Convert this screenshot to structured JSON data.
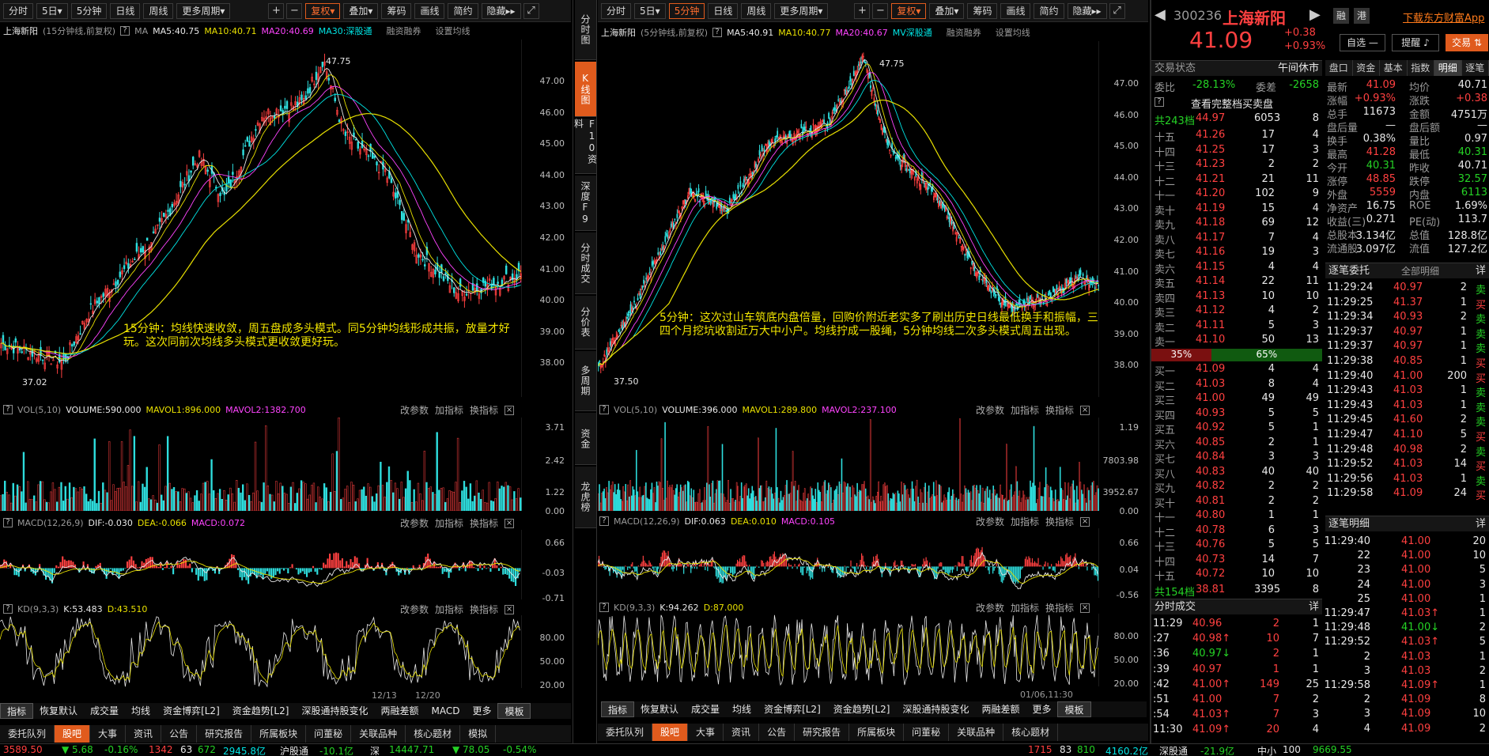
{
  "colors": {
    "accent": "#e05b1d",
    "up": "#ff4040",
    "down": "#25d225",
    "ma5": "#e8e8e8",
    "ma10": "#e8e000",
    "ma20": "#ff44ff",
    "ma30": "#00e5e5"
  },
  "toolbar_left": [
    "分时",
    "5日▾",
    "5分钟",
    "日线",
    "周线",
    "更多周期▾"
  ],
  "toolbar_left_b": [
    "复权▾",
    "叠加▾",
    "筹码",
    "画线",
    "简约",
    "隐藏▸▸"
  ],
  "toolbar_right": [
    "分时",
    "5日▾",
    "5分钟",
    "日线",
    "周线",
    "更多周期▾"
  ],
  "toolbar_right_b": [
    "复权▾",
    "叠加▾",
    "筹码",
    "画线",
    "简约",
    "隐藏▸▸"
  ],
  "left": {
    "name": "上海新阳",
    "period": "(15分钟线,前复权)",
    "ma_label": "MA",
    "ma5": "MA5:40.75",
    "ma10": "MA10:40.71",
    "ma20": "MA20:40.69",
    "ma30": "MA30:深股通",
    "rz": "融资融券",
    "set": "设置均线",
    "high_label": "47.75",
    "low_label": "37.02",
    "yticks": [
      "47.00",
      "46.00",
      "45.00",
      "44.00",
      "43.00",
      "42.00",
      "41.00",
      "40.00",
      "39.00",
      "38.00"
    ],
    "annotation": "15分钟：均线快速收敛，周五盘成多头模式。同5分钟均线形成共振，放量才好玩。这次同前次均线多头模式更收敛更好玩。",
    "vol": {
      "label": "VOL(5,10)",
      "v": "VOLUME:590.000",
      "m1": "MAVOL1:896.000",
      "m2": "MAVOL2:1382.700",
      "yt": [
        "3.71",
        "2.42",
        "1.22",
        "0.00"
      ]
    },
    "macd": {
      "label": "MACD(12,26,9)",
      "dif": "DIF:-0.030",
      "dea": "DEA:-0.066",
      "m": "MACD:0.072",
      "yt": [
        "0.66",
        "-0.03",
        "-0.71"
      ]
    },
    "kd": {
      "label": "KD(9,3,3)",
      "k": "K:53.483",
      "d": "D:43.510",
      "yt": [
        "80.00",
        "50.00",
        "20.00"
      ]
    },
    "btns": [
      "改参数",
      "加指标",
      "换指标"
    ],
    "dates": [
      "12/13",
      "12/20"
    ]
  },
  "right": {
    "name": "上海新阳",
    "period": "(5分钟线,前复权)",
    "ma5": "MA5:40.91",
    "ma10": "MA10:40.77",
    "ma20": "MA20:40.67",
    "ma30": "MV深股通",
    "rz": "融资融券",
    "set": "设置均线",
    "high_label": "47.75",
    "low_label": "37.50",
    "yticks": [
      "47.00",
      "46.00",
      "45.00",
      "44.00",
      "43.00",
      "42.00",
      "41.00",
      "40.00",
      "39.00",
      "38.00"
    ],
    "annotation": "5分钟：这次过山车筑底内盘倍量，回购价附近老实多了刷出历史日线最低换手和振幅，三四个月挖坑收割近万大中小户。均线拧成一股绳，5分钟均线二次多头模式周五出现。",
    "vol": {
      "label": "VOL(5,10)",
      "v": "VOLUME:396.000",
      "m1": "MAVOL1:289.800",
      "m2": "MAVOL2:237.100",
      "yt": [
        "1.19",
        "7803.98",
        "3952.67",
        "0.00"
      ]
    },
    "macd": {
      "label": "MACD(12,26,9)",
      "dif": "DIF:0.063",
      "dea": "DEA:0.010",
      "m": "MACD:0.105",
      "yt": [
        "0.66",
        "0.04",
        "-0.56"
      ]
    },
    "kd": {
      "label": "KD(9,3,3)",
      "k": "K:94.262",
      "d": "D:87.000",
      "yt": [
        "80.00",
        "50.00",
        "20.00"
      ]
    },
    "btns": [
      "改参数",
      "加指标",
      "换指标"
    ],
    "dates": [
      "01/06,11:30"
    ]
  },
  "vtabs": [
    "分时图",
    "K线图",
    "F10资料",
    "深度F9",
    "分时成交",
    "分价表",
    "多周期",
    "资金",
    "龙虎榜"
  ],
  "ind_tabs": [
    "指标",
    "恢复默认",
    "成交量",
    "均线",
    "资金博弈[L2]",
    "资金趋势[L2]",
    "深股通持股变化",
    "两融差额",
    "MACD",
    "更多",
    "模板"
  ],
  "ind_tabs_r": [
    "指标",
    "恢复默认",
    "成交量",
    "均线",
    "资金博弈[L2]",
    "资金趋势[L2]",
    "深股通持股变化",
    "两融差额",
    "更多",
    "模板"
  ],
  "bottom_tabs": [
    "委托队列",
    "股吧",
    "大事",
    "资讯",
    "公告",
    "研究报告",
    "所属板块",
    "问董秘",
    "关联品种",
    "核心题材",
    "模拟"
  ],
  "bottom_tabs_r": [
    "委托队列",
    "股吧",
    "大事",
    "资讯",
    "公告",
    "研究报告",
    "所属板块",
    "问董秘",
    "关联品种",
    "核心题材"
  ],
  "quote": {
    "code": "300236",
    "name": "上海新阳",
    "rong": "融",
    "gang": "港",
    "download": "下载东方财富App",
    "price": "41.09",
    "chg": "+0.38",
    "pct": "+0.93%",
    "zixuan": "自选 —",
    "tixing": "提醒 ♪",
    "jiaoyi": "交易 ⇅",
    "state_label": "交易状态",
    "state": "午间休市",
    "weibi_l": "委比",
    "weibi": "-28.13%",
    "weicha_l": "委差",
    "weicha": "-2658",
    "fulldepth": "查看完整档买卖盘",
    "ask_total": {
      "l": "共243档",
      "p": "44.97",
      "v": "6053",
      "n": "8"
    },
    "asks": [
      {
        "l": "十五",
        "p": "41.26",
        "v": "17",
        "n": "4"
      },
      {
        "l": "十四",
        "p": "41.25",
        "v": "17",
        "n": "3"
      },
      {
        "l": "十三",
        "p": "41.23",
        "v": "2",
        "n": "2"
      },
      {
        "l": "十二",
        "p": "41.21",
        "v": "21",
        "n": "11"
      },
      {
        "l": "十一",
        "p": "41.20",
        "v": "102",
        "n": "9"
      },
      {
        "l": "卖十",
        "p": "41.19",
        "v": "15",
        "n": "4"
      },
      {
        "l": "卖九",
        "p": "41.18",
        "v": "69",
        "n": "12"
      },
      {
        "l": "卖八",
        "p": "41.17",
        "v": "7",
        "n": "4"
      },
      {
        "l": "卖七",
        "p": "41.16",
        "v": "19",
        "n": "3"
      },
      {
        "l": "卖六",
        "p": "41.15",
        "v": "4",
        "n": "4"
      },
      {
        "l": "卖五",
        "p": "41.14",
        "v": "22",
        "n": "11"
      },
      {
        "l": "卖四",
        "p": "41.13",
        "v": "10",
        "n": "10"
      },
      {
        "l": "卖三",
        "p": "41.12",
        "v": "4",
        "n": "2"
      },
      {
        "l": "卖二",
        "p": "41.11",
        "v": "5",
        "n": "3"
      },
      {
        "l": "卖一",
        "p": "41.10",
        "v": "50",
        "n": "13"
      }
    ],
    "ratio_l": "35%",
    "ratio_r": "65%",
    "bids": [
      {
        "l": "买一",
        "p": "41.09",
        "v": "4",
        "n": "4"
      },
      {
        "l": "买二",
        "p": "41.03",
        "v": "8",
        "n": "4"
      },
      {
        "l": "买三",
        "p": "41.00",
        "v": "49",
        "n": "49"
      },
      {
        "l": "买四",
        "p": "40.93",
        "v": "5",
        "n": "5"
      },
      {
        "l": "买五",
        "p": "40.92",
        "v": "5",
        "n": "1"
      },
      {
        "l": "买六",
        "p": "40.85",
        "v": "2",
        "n": "1"
      },
      {
        "l": "买七",
        "p": "40.84",
        "v": "3",
        "n": "3"
      },
      {
        "l": "买八",
        "p": "40.83",
        "v": "40",
        "n": "40"
      },
      {
        "l": "买九",
        "p": "40.82",
        "v": "2",
        "n": "2"
      },
      {
        "l": "买十",
        "p": "40.81",
        "v": "2",
        "n": "2"
      },
      {
        "l": "十一",
        "p": "40.80",
        "v": "1",
        "n": "1"
      },
      {
        "l": "十二",
        "p": "40.78",
        "v": "6",
        "n": "3"
      },
      {
        "l": "十三",
        "p": "40.76",
        "v": "5",
        "n": "5"
      },
      {
        "l": "十四",
        "p": "40.73",
        "v": "14",
        "n": "7"
      },
      {
        "l": "十五",
        "p": "40.72",
        "v": "10",
        "n": "10"
      }
    ],
    "bid_total": {
      "l": "共154档",
      "p": "38.81",
      "v": "3395",
      "n": "8"
    },
    "side_tabs": [
      "盘口",
      "资金",
      "基本",
      "指数",
      "明细",
      "逐笔"
    ],
    "stats": [
      [
        "最新",
        "41.09",
        "均价",
        "40.71"
      ],
      [
        "涨幅",
        "+0.93%",
        "涨跌",
        "+0.38"
      ],
      [
        "总手",
        "11673",
        "金额",
        "4751万"
      ],
      [
        "盘后量",
        "—",
        "盘后额",
        "—"
      ],
      [
        "换手",
        "0.38%",
        "量比",
        "0.97"
      ],
      [
        "最高",
        "41.28",
        "最低",
        "40.31"
      ],
      [
        "今开",
        "40.31",
        "昨收",
        "40.71"
      ],
      [
        "涨停",
        "48.85",
        "跌停",
        "32.57"
      ],
      [
        "外盘",
        "5559",
        "内盘",
        "6113"
      ],
      [
        "净资产",
        "16.75",
        "ROE",
        "1.69%"
      ],
      [
        "收益(三)",
        "0.271",
        "PE(动)",
        "113.7"
      ],
      [
        "总股本",
        "3.134亿",
        "总值",
        "128.8亿"
      ],
      [
        "流通股",
        "3.097亿",
        "流值",
        "127.2亿"
      ]
    ],
    "zbwt_label": "逐笔委托",
    "zbwt_sel": "全部明细",
    "zbwt": [
      [
        "11:29:24",
        "40.97",
        "2",
        "卖"
      ],
      [
        "11:29:25",
        "41.37",
        "1",
        "买"
      ],
      [
        "11:29:34",
        "40.93",
        "2",
        "卖"
      ],
      [
        "11:29:37",
        "40.97",
        "1",
        "卖"
      ],
      [
        "11:29:37",
        "40.97",
        "1",
        "卖"
      ],
      [
        "11:29:38",
        "40.85",
        "1",
        "买"
      ],
      [
        "11:29:40",
        "41.00",
        "200",
        "买"
      ],
      [
        "11:29:43",
        "41.03",
        "1",
        "卖"
      ],
      [
        "11:29:43",
        "41.03",
        "1",
        "卖"
      ],
      [
        "11:29:45",
        "41.60",
        "2",
        "卖"
      ],
      [
        "11:29:47",
        "41.10",
        "5",
        "买"
      ],
      [
        "11:29:48",
        "40.98",
        "2",
        "卖"
      ],
      [
        "11:29:52",
        "41.03",
        "14",
        "买"
      ],
      [
        "11:29:56",
        "41.03",
        "1",
        "卖"
      ],
      [
        "11:29:58",
        "41.09",
        "24",
        "买"
      ]
    ],
    "zbmx_label": "逐笔明细",
    "zbmx": [
      [
        "11:29:40",
        "41.00",
        "20"
      ],
      [
        "22",
        "41.00",
        "10"
      ],
      [
        "23",
        "41.00",
        "5"
      ],
      [
        "24",
        "41.00",
        "3"
      ],
      [
        "25",
        "41.00",
        "1"
      ],
      [
        "11:29:47",
        "41.03↑",
        "1"
      ],
      [
        "11:29:48",
        "41.00↓",
        "2"
      ],
      [
        "11:29:52",
        "41.03↑",
        "5"
      ],
      [
        "2",
        "41.03",
        "1"
      ],
      [
        "3",
        "41.03",
        "2"
      ],
      [
        "11:29:58",
        "41.09↑",
        "1"
      ],
      [
        "2",
        "41.09",
        "8"
      ],
      [
        "3",
        "41.09",
        "10"
      ],
      [
        "4",
        "41.09",
        "2"
      ]
    ],
    "fscj_label": "分时成交",
    "fscj": [
      [
        "11:29",
        "40.96",
        "2",
        "1"
      ],
      [
        ":27",
        "40.98↑",
        "10",
        "7"
      ],
      [
        ":36",
        "40.97↓",
        "2",
        "1"
      ],
      [
        ":39",
        "40.97",
        "1",
        "1"
      ],
      [
        ":42",
        "41.00↑",
        "149",
        "25"
      ],
      [
        ":51",
        "41.00",
        "7",
        "2"
      ],
      [
        ":54",
        "41.03↑",
        "7",
        "3"
      ],
      [
        "11:30",
        "41.09↑",
        "20",
        "4"
      ]
    ],
    "xiang": "详"
  },
  "status": {
    "l1": "3589.50",
    "l2": "▼ 5.68",
    "l3": "-0.16%",
    "l4": "1342",
    "l5": "63",
    "l6": "672",
    "l7": "2945.8亿",
    "l8": "沪股通",
    "l9": "-10.1亿",
    "l10": "深",
    "l11": "14447.71",
    "l12": "▼ 78.05",
    "l13": "-0.54%",
    "l14": "1715",
    "l15": "83",
    "l16": "810",
    "l17": "4160.2亿",
    "l18": "深股通",
    "l19": "-21.9亿",
    "l20": "中小",
    "l21": "100",
    "l22": "9669.55"
  }
}
